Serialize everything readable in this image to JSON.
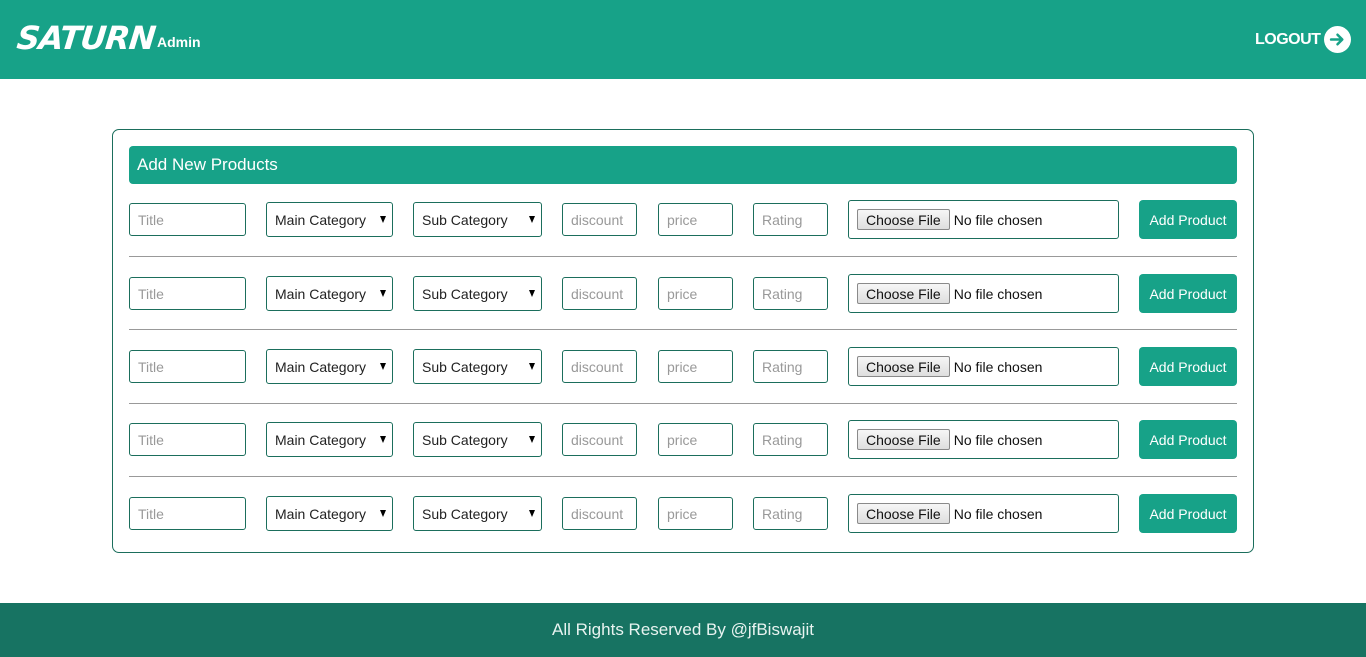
{
  "header": {
    "brand": "SATURN",
    "brand_sub": "Admin",
    "logout_label": "LOGOUT"
  },
  "card": {
    "title": "Add New Products"
  },
  "form": {
    "placeholders": {
      "title": "Title",
      "discount": "discount",
      "price": "price",
      "rating": "Rating"
    },
    "main_category": "Main Category",
    "sub_category": "Sub Category",
    "file_button": "Choose File",
    "file_status": "No file chosen",
    "submit_label": "Add Product",
    "rows": [
      1,
      2,
      3,
      4,
      5
    ]
  },
  "footer": {
    "text": "All Rights Reserved By @jfBiswajit"
  },
  "colors": {
    "accent": "#17a288",
    "footer": "#177362",
    "border": "#1b6e5c"
  },
  "icons": {
    "logout": "arrow-right-circle-icon",
    "select": "caret-down-icon"
  }
}
